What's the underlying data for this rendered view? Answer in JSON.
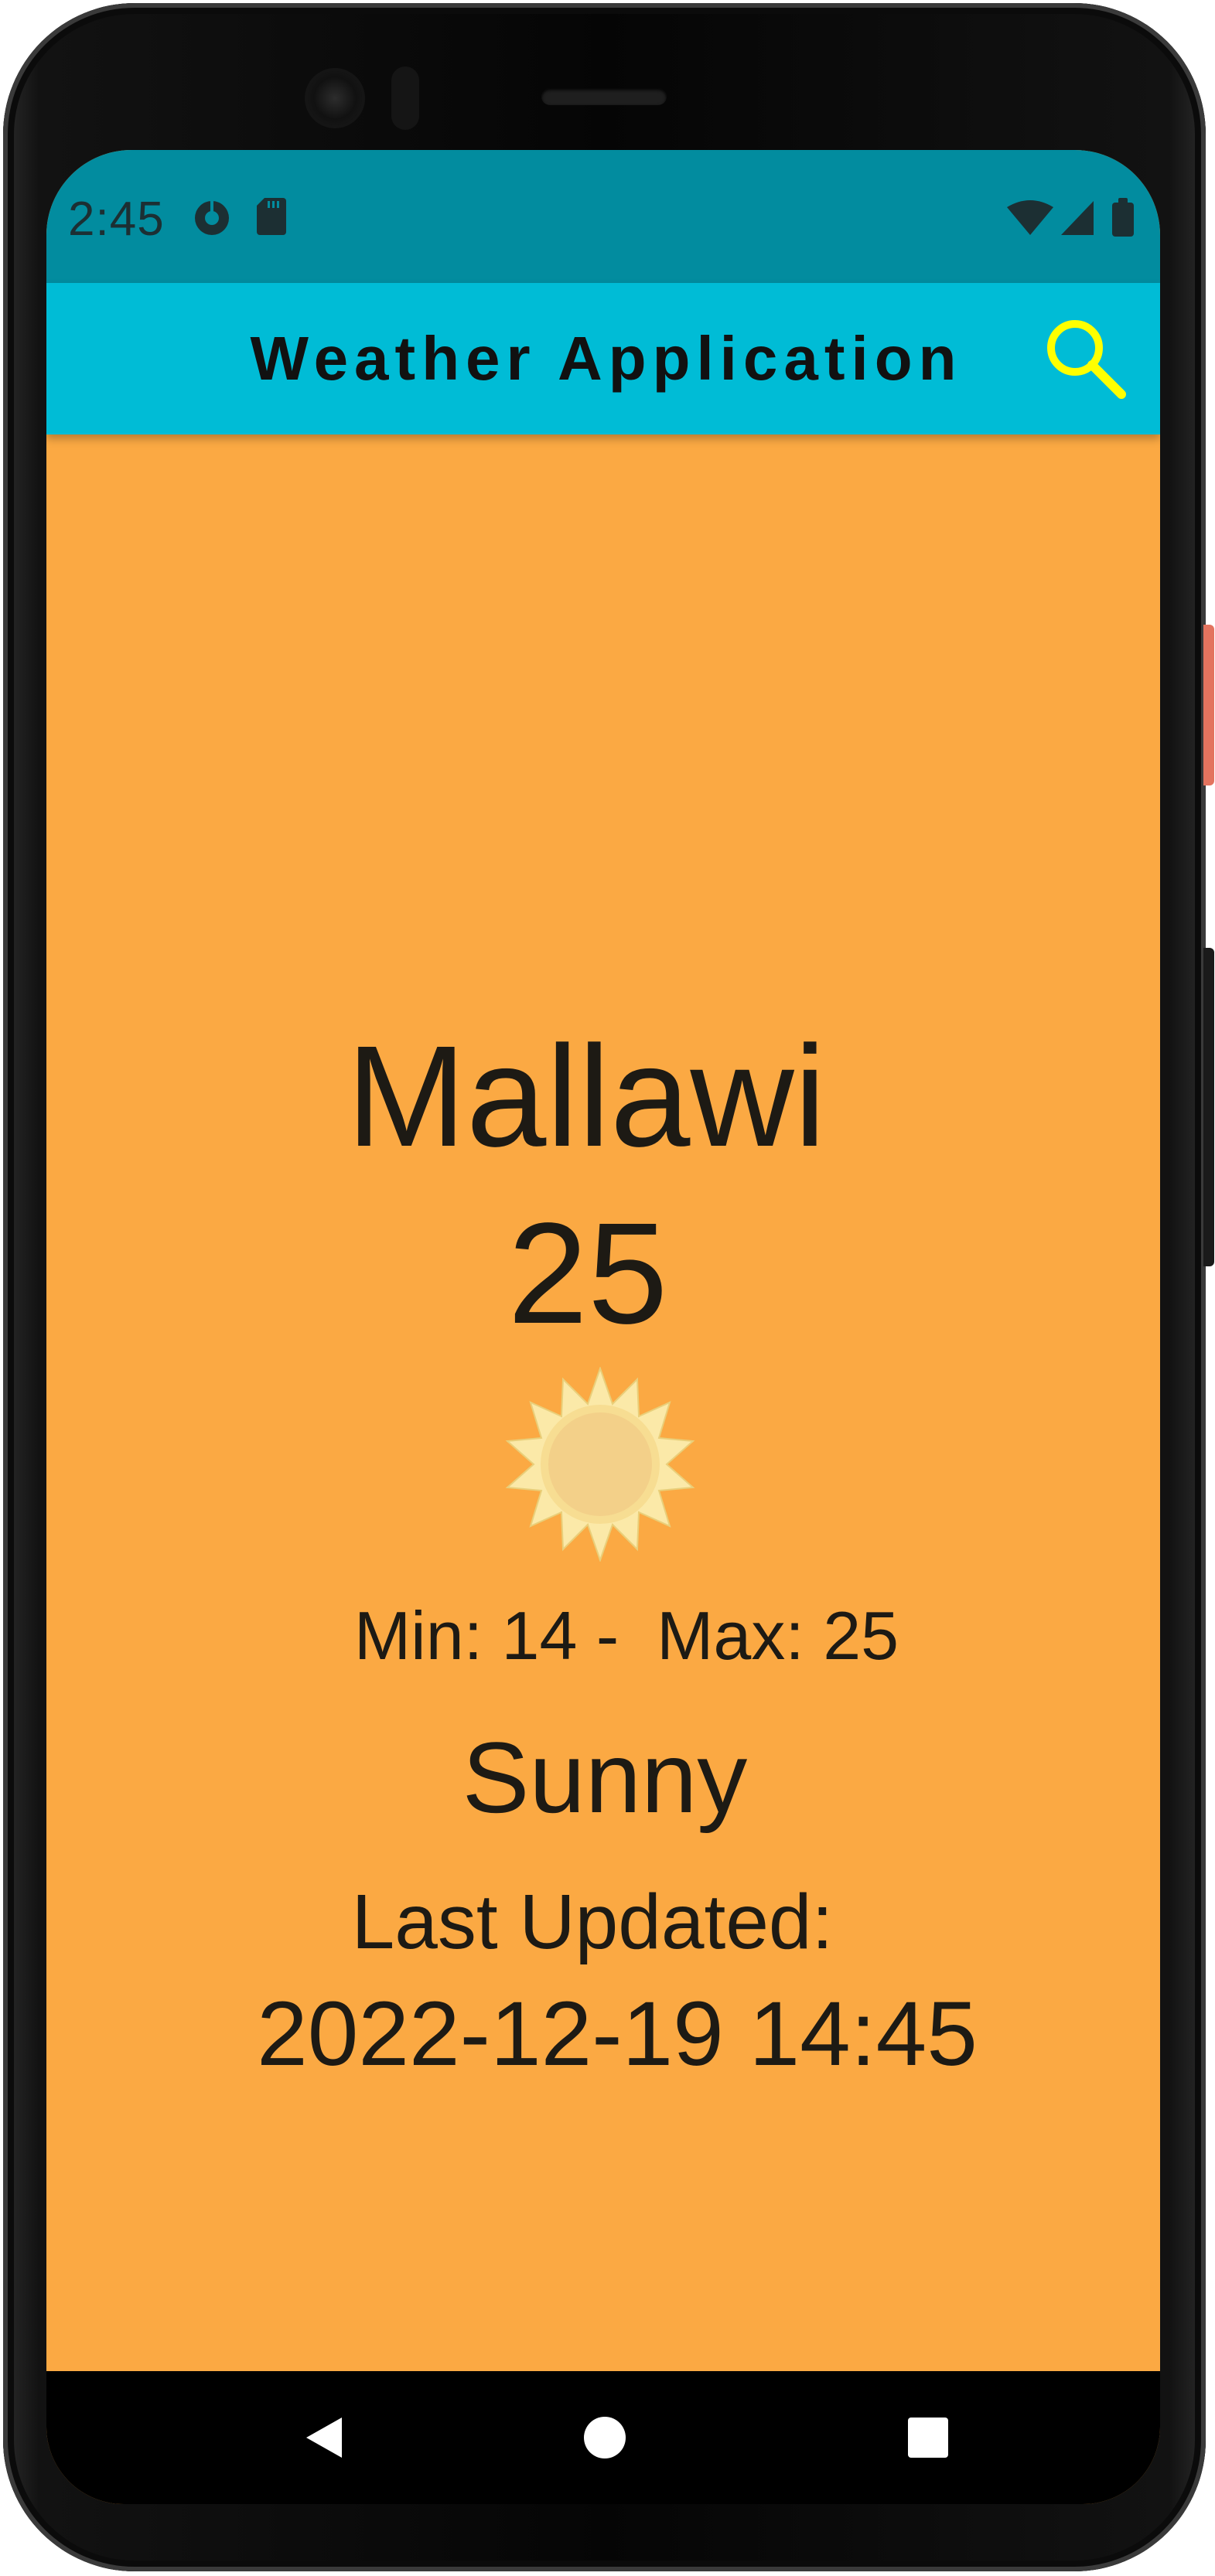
{
  "status_bar": {
    "time": "2:45",
    "left_icons": [
      "media-icon",
      "sd-card-icon"
    ],
    "right_icons": [
      "wifi-icon",
      "cellular-signal-icon",
      "battery-icon"
    ]
  },
  "app_bar": {
    "title": "Weather Application",
    "action_icon": "search-icon",
    "action_color": "#ffff00"
  },
  "weather": {
    "city": "Mallawi",
    "temperature": "25",
    "icon": "sun-icon",
    "min_max": "Min: 14 -  Max: 25",
    "condition": "Sunny",
    "last_updated_label": "Last Updated:",
    "last_updated_value": "2022-12-19 14:45"
  },
  "nav_bar": {
    "buttons": [
      "back-icon",
      "home-icon",
      "recents-icon"
    ]
  },
  "colors": {
    "status_bar": "#028c9f",
    "app_bar": "#00bcd6",
    "background": "#fba943",
    "text": "#1d1a14"
  }
}
